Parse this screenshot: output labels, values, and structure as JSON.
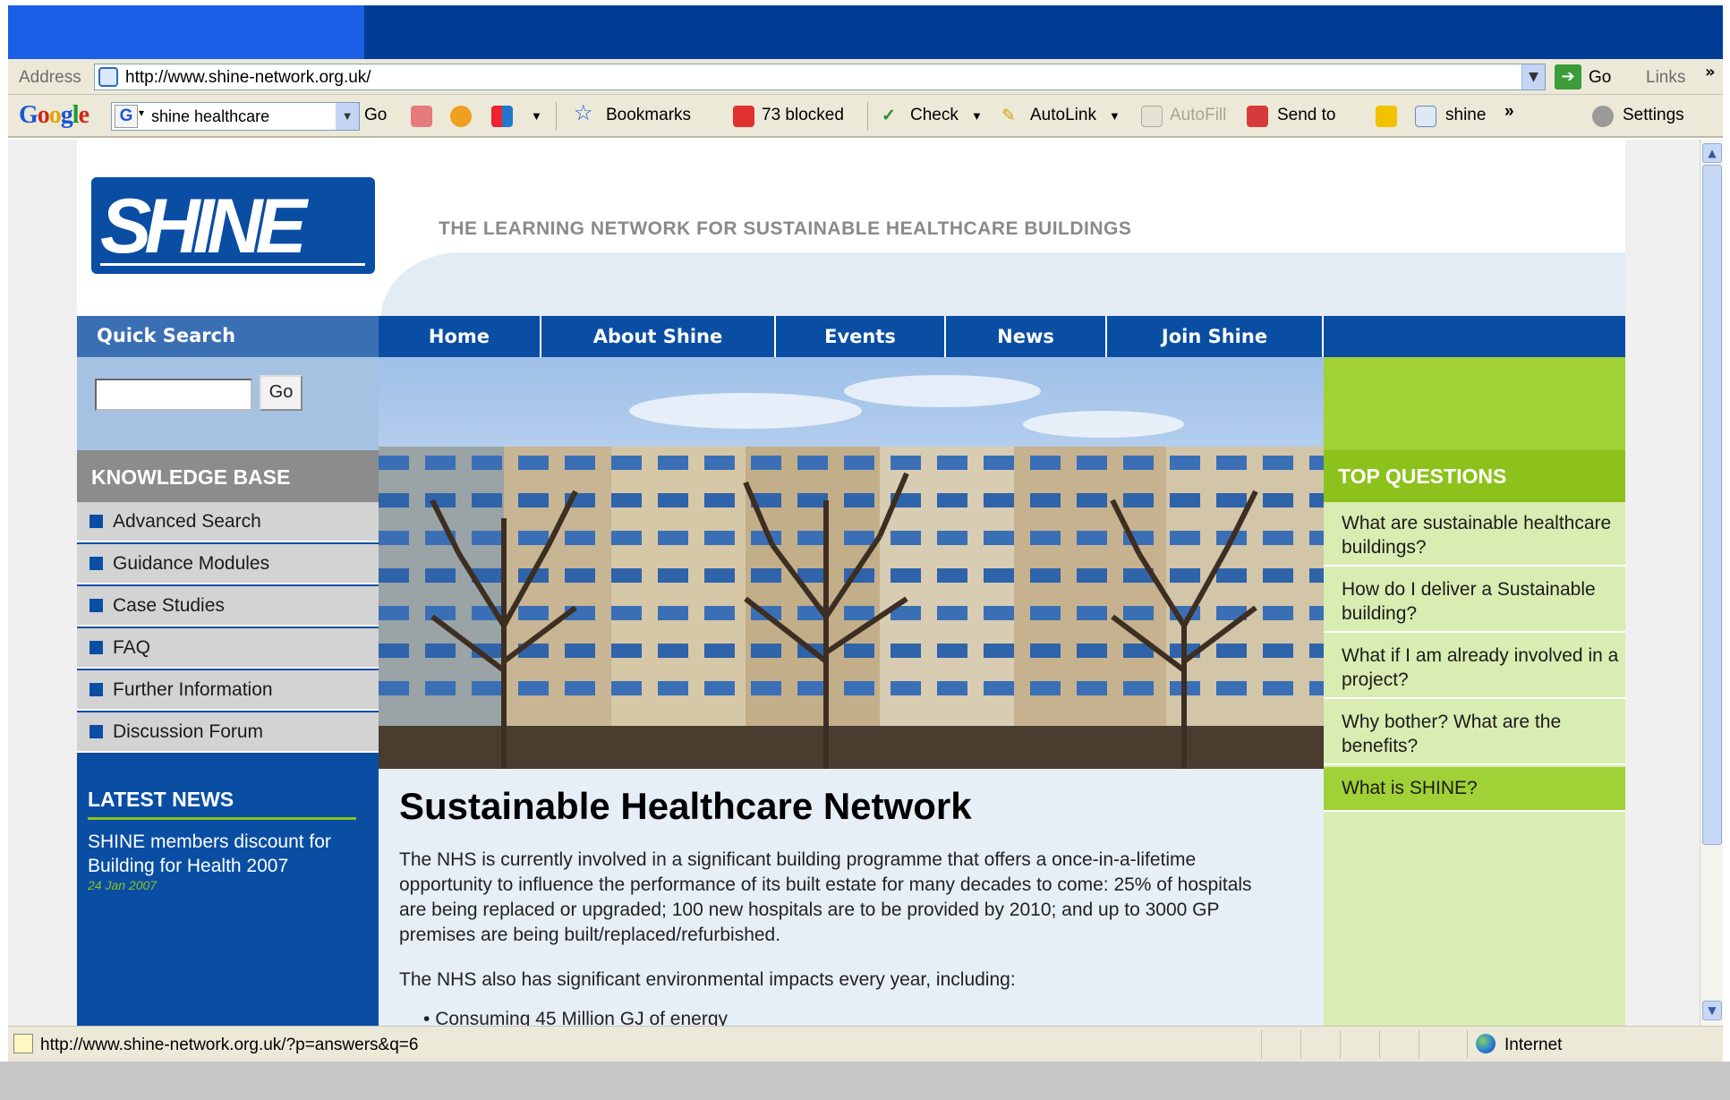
{
  "browser": {
    "address_label": "Address",
    "url": "http://www.shine-network.org.uk/",
    "go_label": "Go",
    "links_label": "Links",
    "links_chevron": "»",
    "toolbar": {
      "google_search_value": "shine healthcare",
      "go_label": "Go",
      "bookmarks_label": "Bookmarks",
      "blocked_label": "73 blocked",
      "check_label": "Check",
      "autolink_label": "AutoLink",
      "autofill_label": "AutoFill",
      "sendto_label": "Send to",
      "shine_label": "shine",
      "more_chevron": "»",
      "settings_label": "Settings"
    },
    "status_url": "http://www.shine-network.org.uk/?p=answers&q=6",
    "zone_label": "Internet"
  },
  "site": {
    "logo_text": "SHINE",
    "tagline": "THE LEARNING NETWORK FOR SUSTAINABLE HEALTHCARE BUILDINGS",
    "quick_search_label": "Quick Search",
    "search_go_label": "Go",
    "nav": [
      "Home",
      "About Shine",
      "Events",
      "News",
      "Join Shine"
    ],
    "knowledge_base": {
      "title": "KNOWLEDGE BASE",
      "items": [
        "Advanced Search",
        "Guidance Modules",
        "Case Studies",
        "FAQ",
        "Further Information",
        "Discussion Forum"
      ]
    },
    "latest_news": {
      "title": "LATEST NEWS",
      "headline": "SHINE members discount for Building for Health 2007",
      "date": "24 Jan 2007"
    },
    "top_questions": {
      "title": "TOP QUESTIONS",
      "items": [
        "What are sustainable healthcare buildings?",
        "How do I deliver a Sustainable building?",
        "What if I am already involved in a project?",
        "Why bother? What are the benefits?",
        "What is SHINE?"
      ]
    },
    "main": {
      "heading": "Sustainable Healthcare Network",
      "paragraph1": "The NHS is currently involved in a significant building programme that offers a once-in-a-lifetime opportunity to influence the performance of its built estate for many decades to come: 25% of hospitals are being replaced or upgraded; 100 new hospitals are to be provided by 2010; and up to 3000 GP premises are being built/replaced/refurbished.",
      "paragraph2": "The NHS also has significant environmental impacts every year, including:",
      "bullet1": "Consuming 45 Million GJ of energy"
    }
  },
  "colors": {
    "brand_blue": "#0a4ea4",
    "brand_green": "#8cc21b",
    "light_green": "#d9ecb2",
    "kb_gray": "#8c8c8c"
  },
  "icons": [
    "page-icon",
    "go-arrow-icon",
    "google-g-icon",
    "bookmarks-star-icon",
    "popup-blocker-icon",
    "spellcheck-icon",
    "autolink-icon",
    "autofill-icon",
    "sendto-icon",
    "highlight-icon",
    "search-shine-icon",
    "settings-wrench-icon",
    "status-page-icon",
    "internet-globe-icon",
    "scroll-up-arrow-icon",
    "scroll-down-arrow-icon"
  ]
}
